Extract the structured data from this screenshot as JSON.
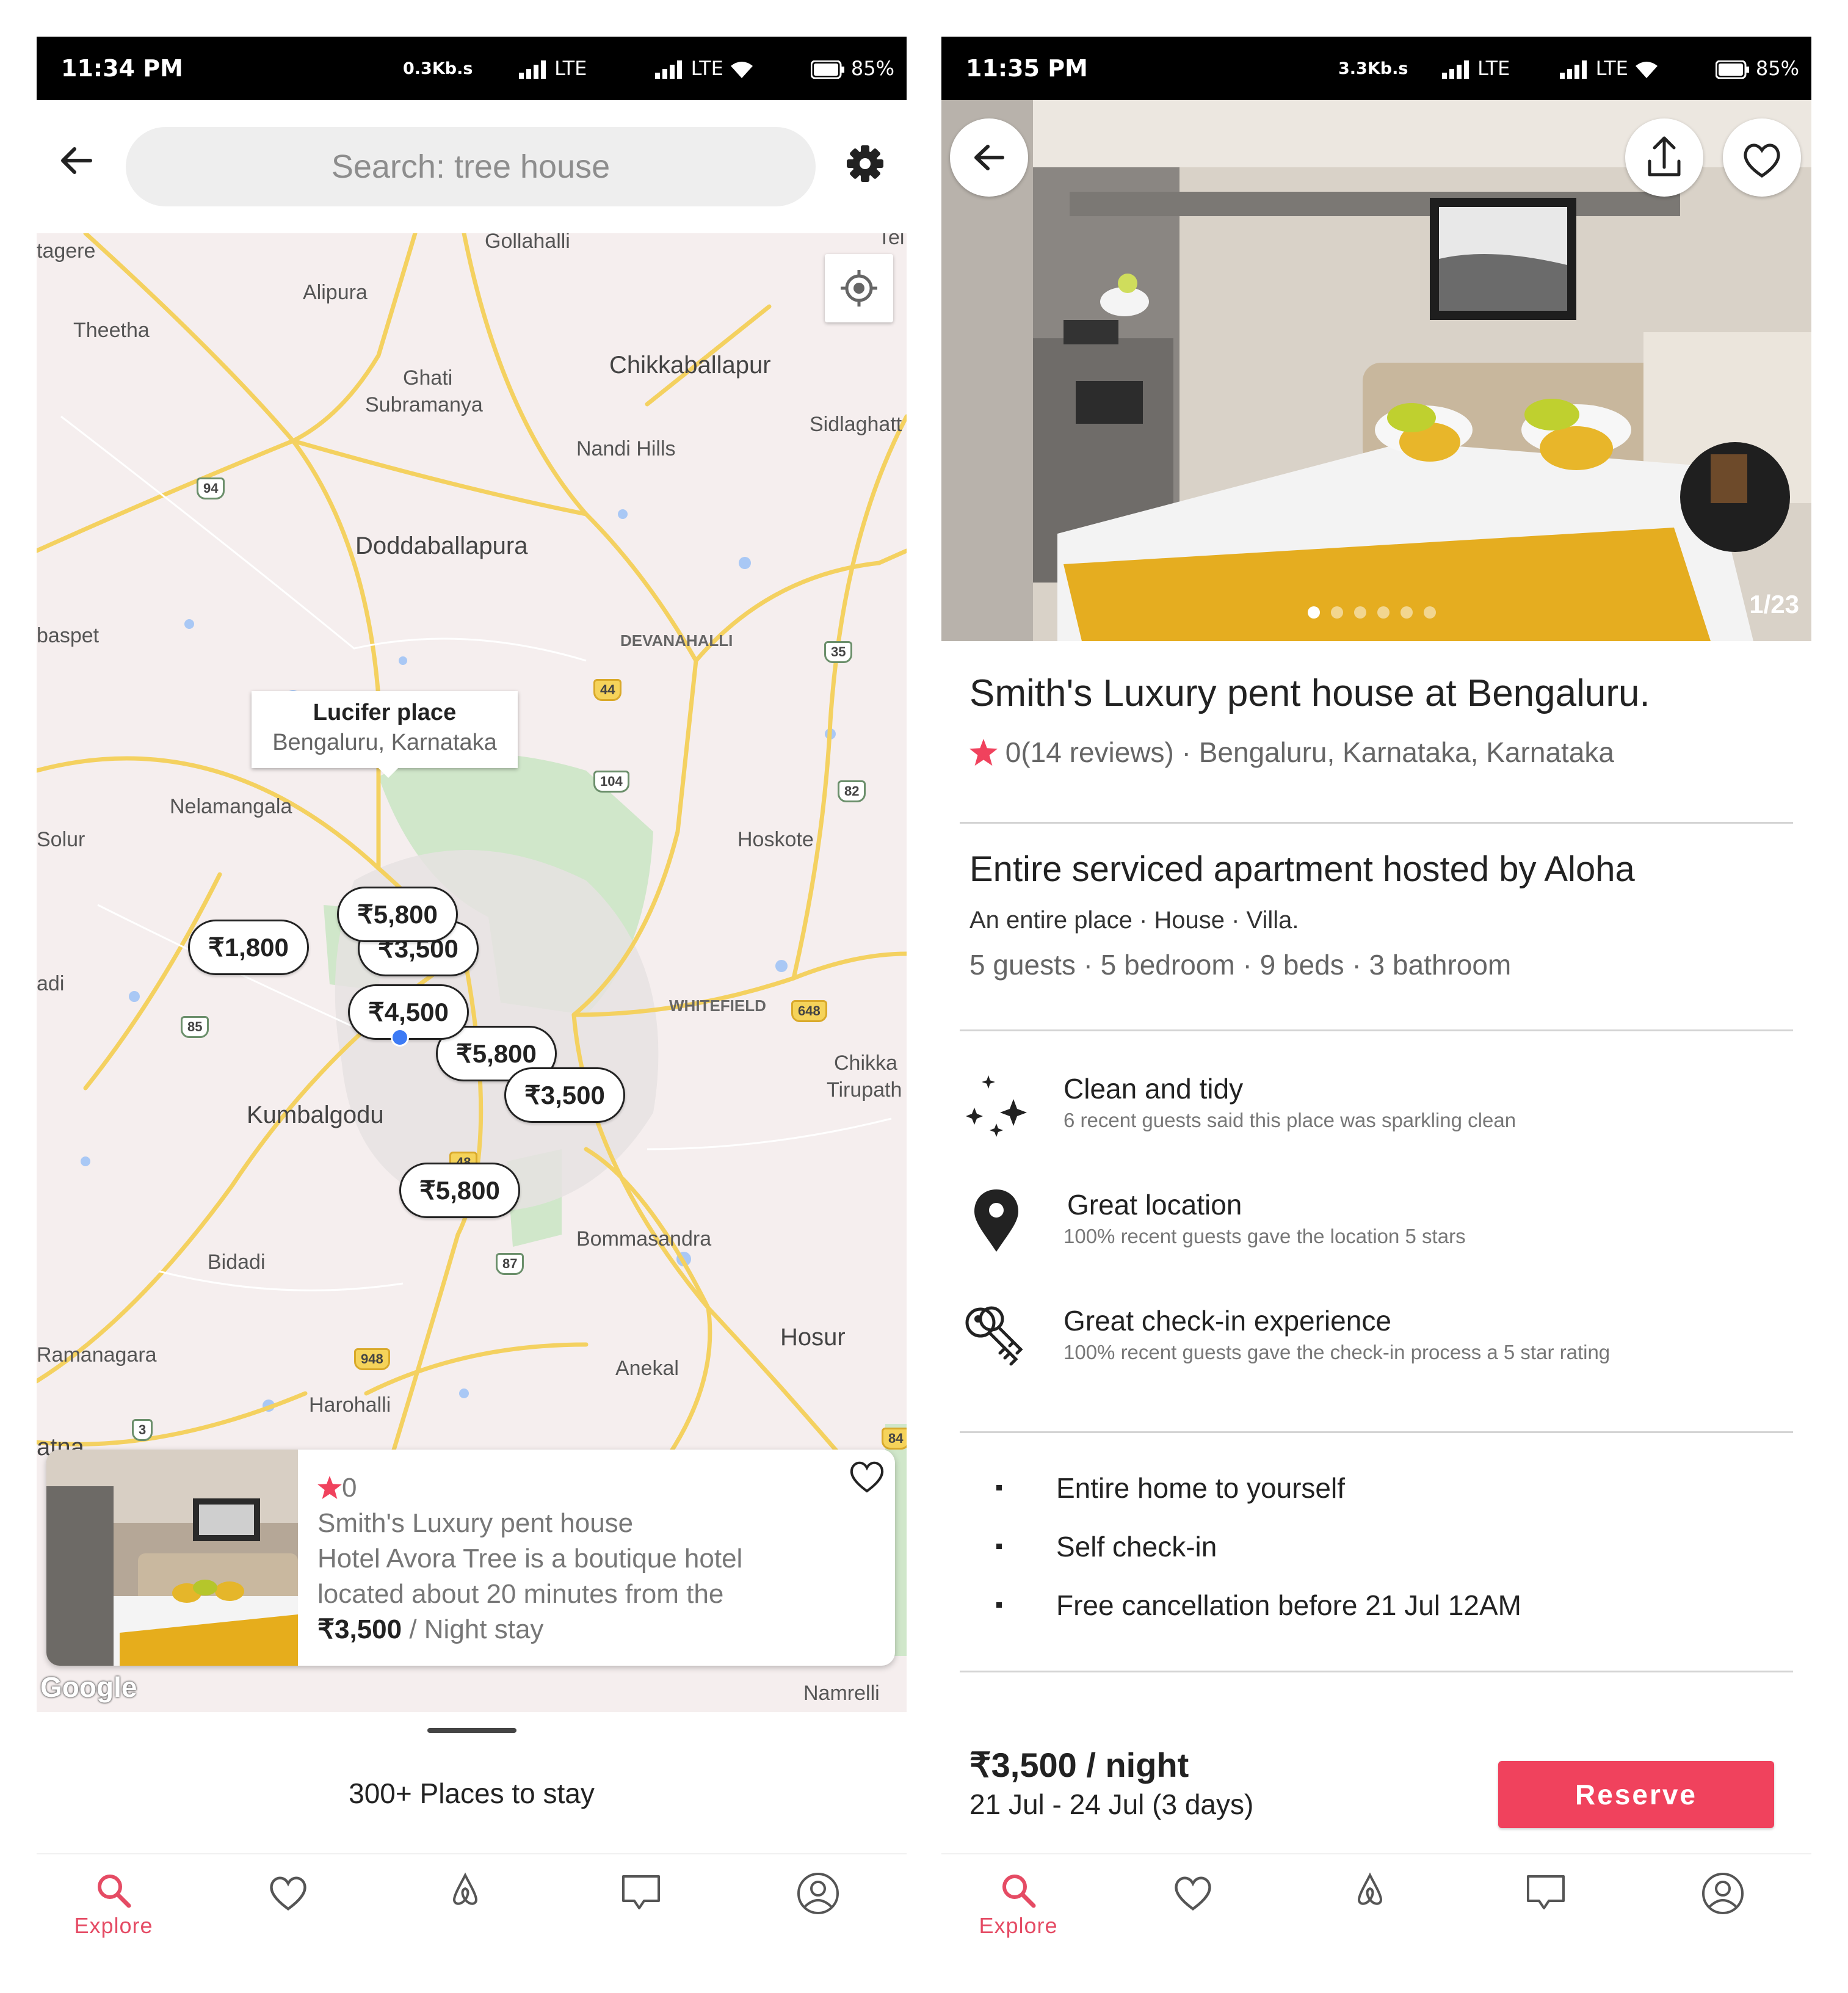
{
  "left_screen": {
    "status_bar": {
      "time": "11:34 PM",
      "speed": "0.3Kb.s",
      "network1": "LTE",
      "network2": "LTE",
      "battery": "85%"
    },
    "search": {
      "placeholder": "Search: tree house"
    },
    "map": {
      "places": [
        "tagere",
        "Gollahalli",
        "Alipura",
        "Theetha",
        "Ghati",
        "Subramanya",
        "Chikkaballapur",
        "Sidlaghatt",
        "Nandi Hills",
        "Doddaballapura",
        "baspet",
        "DEVANAHALLI",
        "Nelamangala",
        "Solur",
        "Hoskote",
        "adi",
        "WHITEFIELD",
        "Chikka",
        "Tirupath",
        "Kumbalgodu",
        "Bommasandra",
        "Bidadi",
        "Hosur",
        "Ramanagara",
        "Anekal",
        "Harohalli",
        "atna",
        "Namrelli",
        "Tel"
      ],
      "highway_shields": [
        "94",
        "35",
        "44",
        "104",
        "82",
        "85",
        "648",
        "48",
        "87",
        "948",
        "3",
        "84"
      ],
      "callout": {
        "title": "Lucifer place",
        "subtitle": "Bengaluru, Karnataka"
      },
      "price_markers": [
        "₹5,800",
        "₹1,800",
        "₹3,500",
        "₹4,500",
        "₹5,800",
        "₹3,500",
        "₹5,800"
      ],
      "attribution": "Google"
    },
    "listing_card": {
      "rating": "0",
      "title": "Smith's Luxury pent house",
      "description_line1": "Hotel Avora Tree is a boutique hotel",
      "description_line2": "located about 20 minutes from the",
      "price": "₹3,500",
      "price_suffix": " / Night stay"
    },
    "places_count": "300+ Places to stay",
    "nav": {
      "explore": "Explore"
    }
  },
  "right_screen": {
    "status_bar": {
      "time": "11:35 PM",
      "speed": "3.3Kb.s",
      "network1": "LTE",
      "network2": "LTE",
      "battery": "85%"
    },
    "photo_counter": "1/23",
    "title": "Smith's Luxury pent house at Bengaluru.",
    "meta": "0(14 reviews) · Bengaluru, Karnataka, Karnataka",
    "host_title": "Entire serviced apartment hosted by Aloha",
    "host_sub": "An entire place · House · Villa.",
    "host_stats": "5 guests · 5 bedroom · 9 beds · 3 bathroom",
    "features": [
      {
        "title": "Clean and tidy",
        "subtitle": "6 recent guests said this place was sparkling clean",
        "icon": "sparkles-icon"
      },
      {
        "title": "Great location",
        "subtitle": "100% recent guests gave the location 5 stars",
        "icon": "location-pin-icon"
      },
      {
        "title": "Great check-in experience",
        "subtitle": "100% recent guests gave the check-in process a 5 star rating",
        "icon": "keys-icon"
      }
    ],
    "bullets": [
      "Entire home to yourself",
      "Self check-in",
      "Free cancellation before 21 Jul 12AM"
    ],
    "price_night": "₹3,500 / night",
    "dates": "21 Jul - 24 Jul (3 days)",
    "reserve_label": "Reserve",
    "nav": {
      "explore": "Explore"
    }
  },
  "colors": {
    "accent": "#f0425d",
    "nav_active": "#e54b64",
    "map_bg": "#f5eeee",
    "road": "#f4d160"
  }
}
